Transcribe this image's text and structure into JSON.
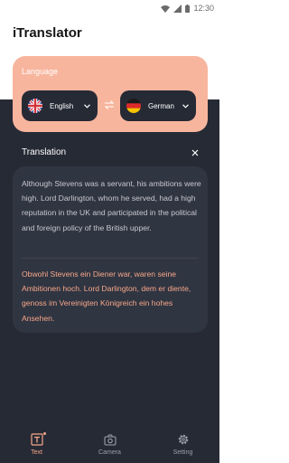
{
  "status_bar": {
    "time": "12:30"
  },
  "app": {
    "title": "iTranslator"
  },
  "language_card": {
    "label": "Language",
    "source_language": "English",
    "target_language": "German"
  },
  "translation": {
    "title": "Translation",
    "source_text": "Although Stevens was a servant, his ambitions were high. Lord Darlington, whom he served, had a high reputation in the UK and participated in the political and foreign policy of the British upper.",
    "translated_text": "Obwohl Stevens ein Diener war, waren seine Ambitionen hoch. Lord Darlington, dem er diente, genoss im Vereinigten Königreich ein hohes Ansehen."
  },
  "tabs": [
    {
      "label": "Text",
      "icon": "text-icon",
      "active": true
    },
    {
      "label": "Camera",
      "icon": "camera-icon",
      "active": false
    },
    {
      "label": "Setting",
      "icon": "gear-icon",
      "active": false
    }
  ],
  "colors": {
    "accent": "#f8b59d",
    "dark": "#262a35",
    "card": "#303542",
    "translation_text": "#f6a789"
  }
}
